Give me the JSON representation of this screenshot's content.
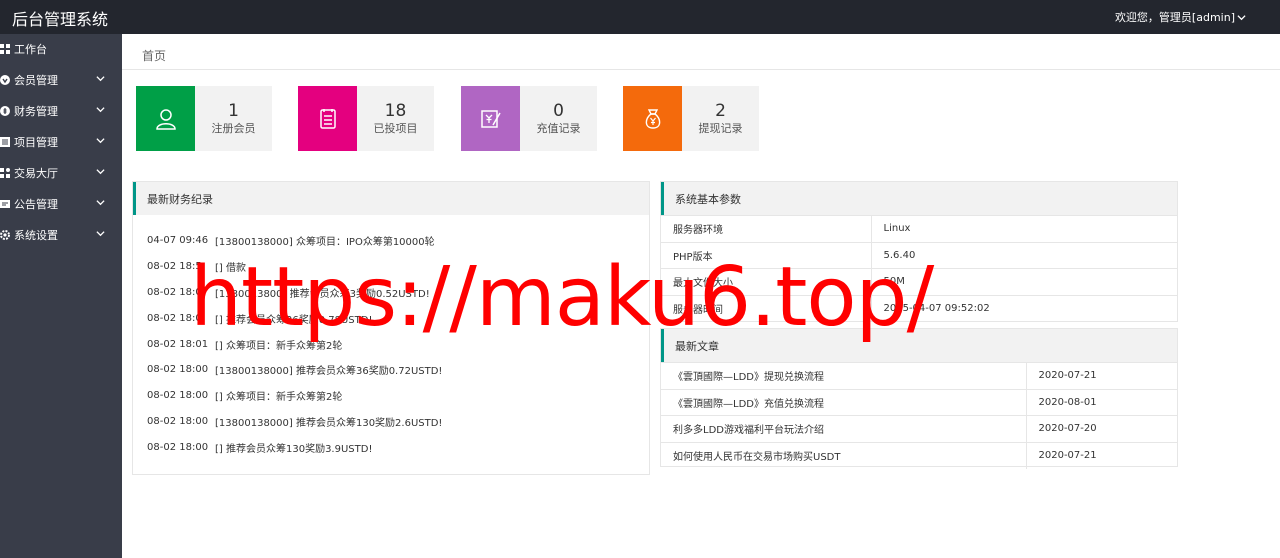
{
  "header": {
    "title": "后台管理系统",
    "user_label": "欢迎您，管理员[admin]"
  },
  "sidebar": {
    "items": [
      {
        "label": "工作台",
        "icon": "dashboard-icon",
        "has_children": false
      },
      {
        "label": "会员管理",
        "icon": "heart-icon",
        "has_children": true
      },
      {
        "label": "财务管理",
        "icon": "money-icon",
        "has_children": true
      },
      {
        "label": "项目管理",
        "icon": "list-icon",
        "has_children": true
      },
      {
        "label": "交易大厅",
        "icon": "grid-icon",
        "has_children": true
      },
      {
        "label": "公告管理",
        "icon": "notice-icon",
        "has_children": true
      },
      {
        "label": "系统设置",
        "icon": "gear-icon",
        "has_children": true
      }
    ]
  },
  "breadcrumb": {
    "current": "首页"
  },
  "stats": [
    {
      "value": "1",
      "label": "注册会员",
      "color": "#009f47",
      "icon": "user-icon"
    },
    {
      "value": "18",
      "label": "已投项目",
      "color": "#e4007f",
      "icon": "document-icon"
    },
    {
      "value": "0",
      "label": "充值记录",
      "color": "#b066c3",
      "icon": "recharge-icon"
    },
    {
      "value": "2",
      "label": "提现记录",
      "color": "#f46a0c",
      "icon": "money-bag-icon"
    }
  ],
  "finance": {
    "title": "最新财务纪录",
    "items": [
      {
        "time": "04-07 09:46",
        "text": "[13800138000] 众筹项目：IPO众筹第10000轮"
      },
      {
        "time": "08-02 18:5",
        "text": "[] 借款"
      },
      {
        "time": "08-02 18:0",
        "text": "[1380013800] 推荐会员众筹3奖励0.52USTD!"
      },
      {
        "time": "08-02 18:0",
        "text": "[] 推荐会员众筹26奖励0.78USTD!"
      },
      {
        "time": "08-02 18:01",
        "text": "[] 众筹项目：新手众筹第2轮"
      },
      {
        "time": "08-02 18:00",
        "text": "[13800138000] 推荐会员众筹36奖励0.72USTD!"
      },
      {
        "time": "08-02 18:00",
        "text": "[] 众筹项目：新手众筹第2轮"
      },
      {
        "time": "08-02 18:00",
        "text": "[13800138000] 推荐会员众筹130奖励2.6USTD!"
      },
      {
        "time": "08-02 18:00",
        "text": "[] 推荐会员众筹130奖励3.9USTD!"
      }
    ]
  },
  "system": {
    "title": "系统基本参数",
    "rows": [
      {
        "key": "服务器环境",
        "value": "Linux"
      },
      {
        "key": "PHP版本",
        "value": "5.6.40"
      },
      {
        "key": "最大文件大小",
        "value": "50M"
      },
      {
        "key": "服务器时间",
        "value": "2025-04-07 09:52:02"
      }
    ]
  },
  "articles": {
    "title": "最新文章",
    "rows": [
      {
        "title": "《雲頂國際—LDD》提现兑换流程",
        "date": "2020-07-21"
      },
      {
        "title": "《雲頂國際—LDD》充值兑换流程",
        "date": "2020-08-01"
      },
      {
        "title": "利多多LDD游戏福利平台玩法介绍",
        "date": "2020-07-20"
      },
      {
        "title": "如何使用人民币在交易市场购买USDT",
        "date": "2020-07-21"
      }
    ]
  },
  "watermark": "https://maku6.top/"
}
